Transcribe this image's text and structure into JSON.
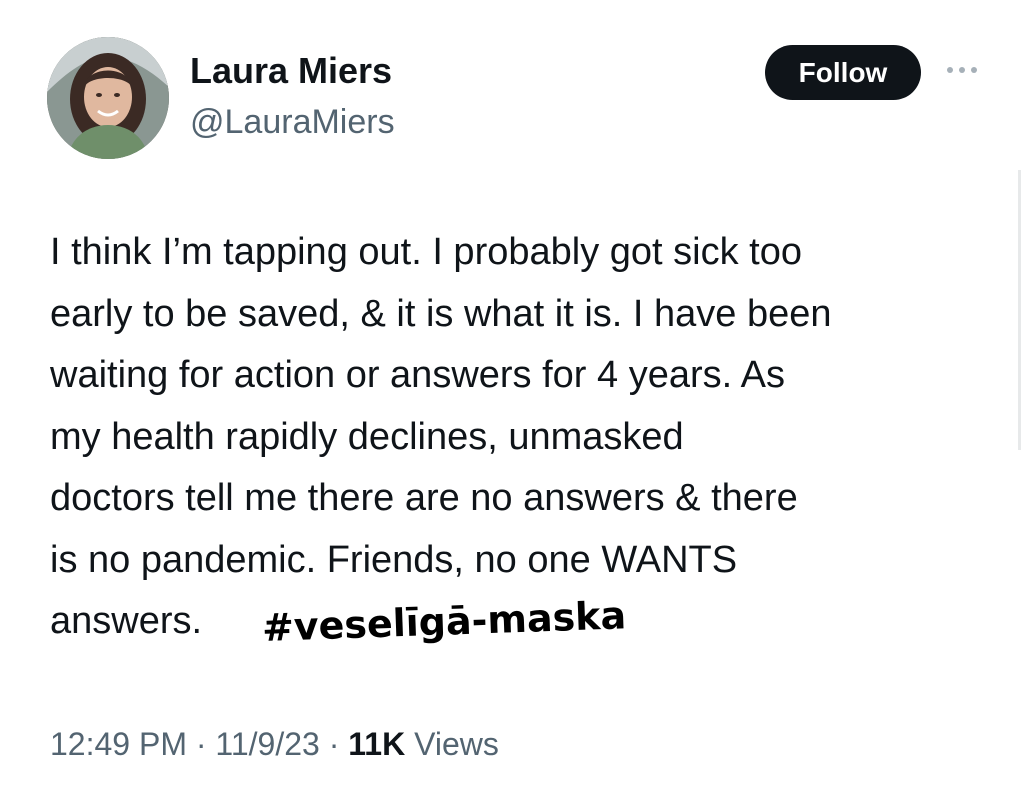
{
  "author": {
    "name": "Laura Miers",
    "handle": "@LauraMiers",
    "avatar_icon": "profile-photo"
  },
  "actions": {
    "follow_label": "Follow",
    "more_icon": "ellipsis-icon"
  },
  "tweet": {
    "lines": [
      "I think I’m tapping out. I probably got sick too",
      "early to be saved, & it is what it is. I have been",
      "waiting for action or answers for 4 years. As",
      "my health rapidly declines, unmasked",
      "doctors tell me there are no answers & there",
      "is no pandemic. Friends, no one WANTS",
      "answers."
    ],
    "hashtag_overlay": "#veselīgā-maska"
  },
  "meta": {
    "time": "12:49 PM",
    "sep1": " · ",
    "date": "11/9/23",
    "sep2": " · ",
    "views_count": "11K",
    "views_label": " Views"
  },
  "colors": {
    "text": "#0f1419",
    "secondary": "#536471",
    "button_bg": "#0f1419",
    "button_text": "#ffffff"
  }
}
